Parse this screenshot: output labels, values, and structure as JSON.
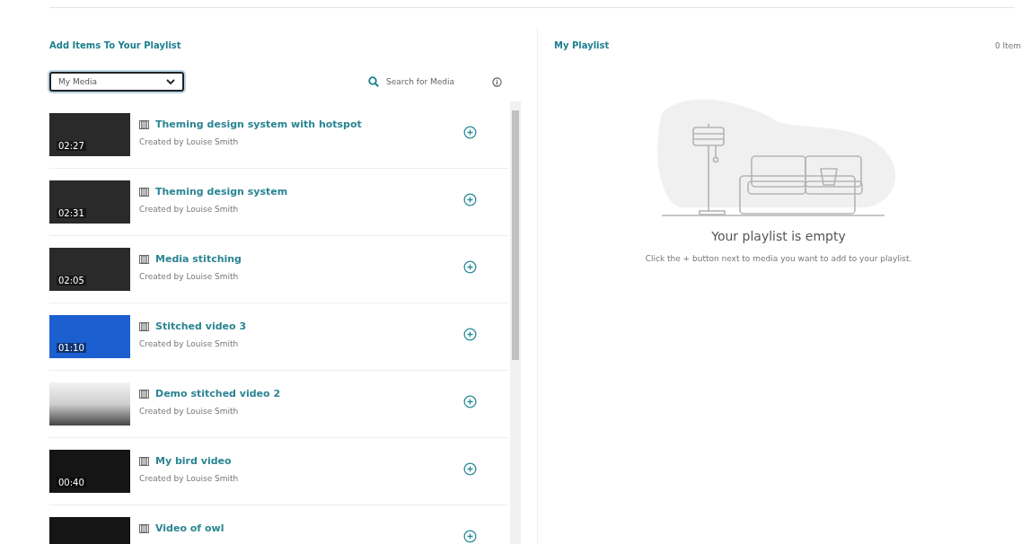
{
  "left_panel": {
    "title": "Add Items To Your Playlist",
    "source_select": {
      "value": "My Media"
    },
    "search": {
      "placeholder": "Search for Media"
    },
    "media_items": [
      {
        "title": "Theming design system with hotspot",
        "creator": "Created by Louise Smith",
        "duration": "02:27"
      },
      {
        "title": "Theming design system",
        "creator": "Created by Louise Smith",
        "duration": "02:31"
      },
      {
        "title": "Media stitching",
        "creator": "Created by Louise Smith",
        "duration": "02:05"
      },
      {
        "title": "Stitched video 3",
        "creator": "Created by Louise Smith",
        "duration": "01:10"
      },
      {
        "title": "Demo stitched video 2",
        "creator": "Created by Louise Smith"
      },
      {
        "title": "My bird video",
        "creator": "Created by Louise Smith",
        "duration": "00:40"
      },
      {
        "title": "Video of owl"
      }
    ]
  },
  "right_panel": {
    "title": "My Playlist",
    "count": "0 Item",
    "empty_state": {
      "heading": "Your playlist is empty",
      "message": "Click the + button next to media you want to add to your playlist."
    }
  }
}
